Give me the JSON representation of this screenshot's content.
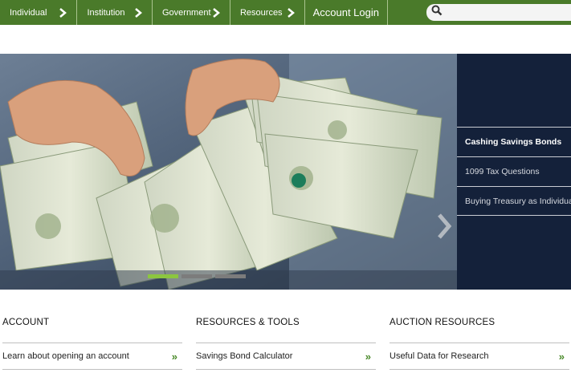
{
  "nav": {
    "items": [
      {
        "label": "Individual"
      },
      {
        "label": "Institution"
      },
      {
        "label": "Government"
      },
      {
        "label": "Resources"
      }
    ],
    "login_label": "Account Login",
    "search_value": ""
  },
  "hero": {
    "active_slide": 1,
    "slide_count": 3
  },
  "side_panel": {
    "items": [
      {
        "label": "Cashing Savings Bonds"
      },
      {
        "label": "1099 Tax Questions"
      },
      {
        "label": "Buying Treasury as Individual"
      }
    ]
  },
  "columns": [
    {
      "title": "ACCOUNT",
      "link": "Learn about opening an account"
    },
    {
      "title": "RESOURCES & TOOLS",
      "link": "Savings Bond Calculator"
    },
    {
      "title": "AUCTION RESOURCES",
      "link": "Useful Data for Research"
    }
  ],
  "colors": {
    "nav_green": "#4a7a2a",
    "accent_green": "#8cc63f",
    "panel_navy": "#14213a"
  }
}
